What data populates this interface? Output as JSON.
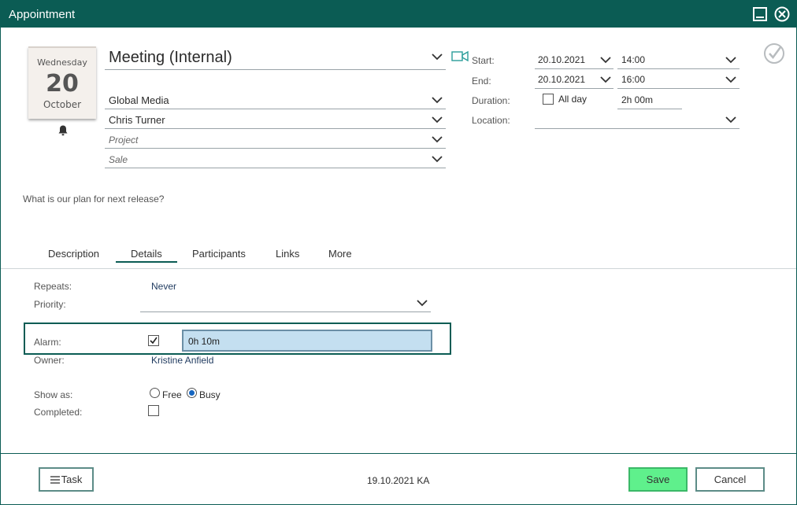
{
  "window": {
    "title": "Appointment"
  },
  "calendar": {
    "weekday": "Wednesday",
    "day": "20",
    "month": "October"
  },
  "main": {
    "subject": "Meeting (Internal)",
    "company": "Global Media",
    "contact": "Chris Turner",
    "project_placeholder": "Project",
    "sale_placeholder": "Sale",
    "agenda": "What is our plan for next release?"
  },
  "timing": {
    "start_label": "Start:",
    "end_label": "End:",
    "duration_label": "Duration:",
    "location_label": "Location:",
    "start_date": "20.10.2021",
    "start_time": "14:00",
    "end_date": "20.10.2021",
    "end_time": "16:00",
    "all_day_label": "All day",
    "all_day_checked": false,
    "duration": "2h 00m",
    "location": ""
  },
  "tabs": [
    {
      "label": "Description"
    },
    {
      "label": "Details",
      "active": true
    },
    {
      "label": "Participants"
    },
    {
      "label": "Links"
    },
    {
      "label": "More"
    }
  ],
  "details": {
    "repeats_label": "Repeats:",
    "repeats_value": "Never",
    "priority_label": "Priority:",
    "priority_value": "",
    "alarm_label": "Alarm:",
    "alarm_checked": true,
    "alarm_value": "0h 10m",
    "owner_label": "Owner:",
    "owner_value": "Kristine Anfield",
    "show_as_label": "Show as:",
    "show_as_options": [
      "Free",
      "Busy"
    ],
    "show_as_selected": "Busy",
    "completed_label": "Completed:",
    "completed_checked": false
  },
  "footer": {
    "task_button": "Task",
    "updated_info": "19.10.2021 KA",
    "save_button": "Save",
    "cancel_button": "Cancel"
  },
  "colors": {
    "header": "#0b5c54",
    "save": "#5ff08c",
    "alarm_input": "#c4dff0",
    "radio_selected": "#1565c0"
  }
}
